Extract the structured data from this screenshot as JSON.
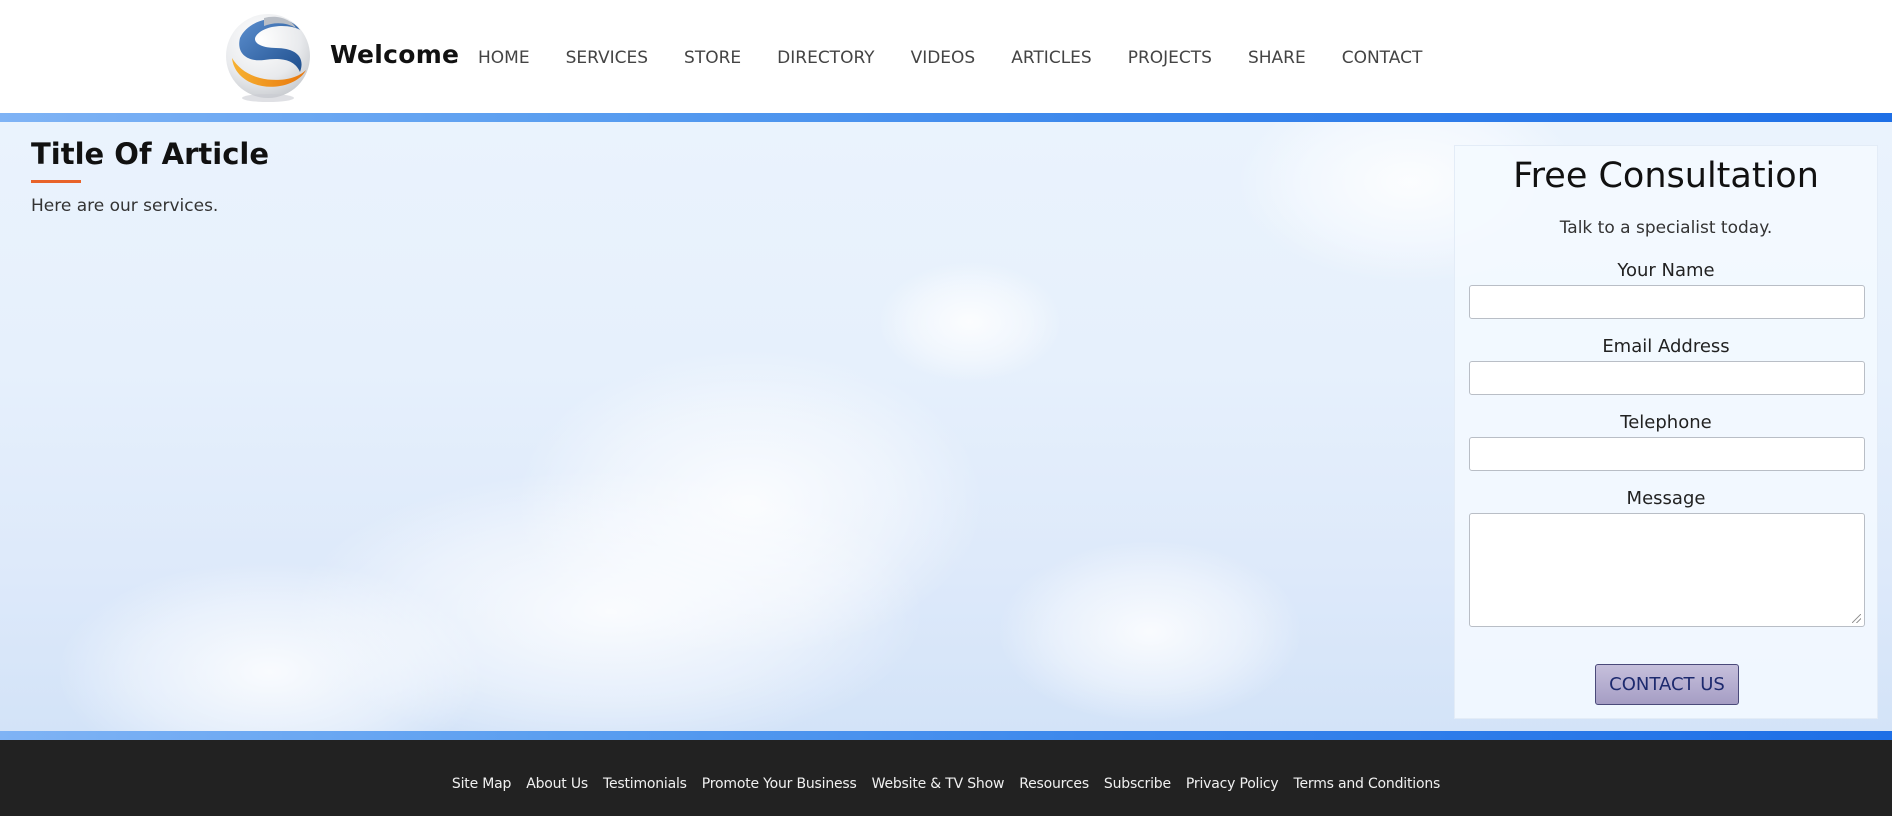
{
  "header": {
    "brand": "Welcome",
    "logo_icon": "globe-swirl-logo",
    "nav": [
      "HOME",
      "SERVICES",
      "STORE",
      "DIRECTORY",
      "VIDEOS",
      "ARTICLES",
      "PROJECTS",
      "SHARE",
      "CONTACT"
    ]
  },
  "article": {
    "title": "Title Of Article",
    "body": "Here are our services."
  },
  "consultation": {
    "title": "Free Consultation",
    "subtitle": "Talk to a specialist today.",
    "fields": {
      "name": {
        "label": "Your Name",
        "value": ""
      },
      "email": {
        "label": "Email Address",
        "value": ""
      },
      "phone": {
        "label": "Telephone",
        "value": ""
      },
      "message": {
        "label": "Message",
        "value": ""
      }
    },
    "button_label": "CONTACT US"
  },
  "footer": {
    "links": [
      "Site Map",
      "About Us",
      "Testimonials",
      "Promote Your Business",
      "Website & TV Show",
      "Resources",
      "Subscribe",
      "Privacy Policy",
      "Terms and Conditions"
    ]
  },
  "colors": {
    "accent_underline": "#e8632a",
    "band_blue": "#1e6fe6",
    "footer_bg": "#222222",
    "button_text": "#1d2a6e"
  }
}
